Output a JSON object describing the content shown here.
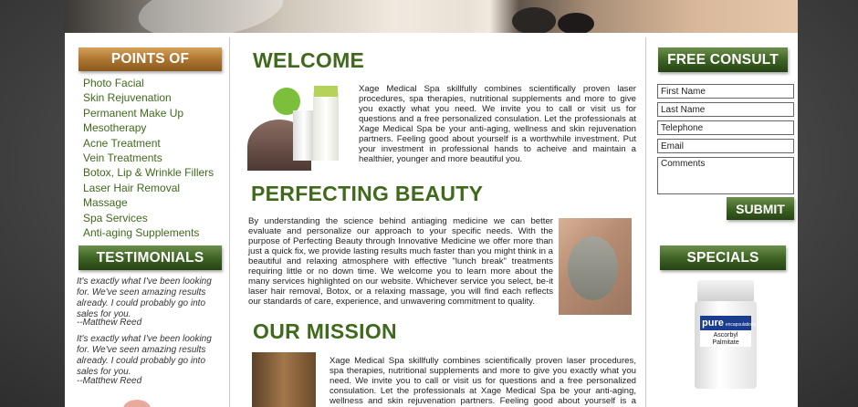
{
  "colors": {
    "accent_green": "#3f6a1c",
    "header_gold": "#ad7530",
    "header_green": "#3e6424"
  },
  "left": {
    "poi_title": "POINTS OF INTEREST",
    "poi_items": [
      "Photo Facial",
      "Skin Rejuvenation",
      "Permanent Make Up",
      "Mesotherapy",
      "Acne Treatment",
      "Vein Treatments",
      "Botox, Lip & Wrinkle Fillers",
      "Laser Hair Removal",
      "Massage",
      "Spa Services",
      "Anti-aging Supplements"
    ],
    "testimonials_title": "TESTIMONIALS",
    "testimonials": [
      {
        "quote": "It's exactly what I've been looking for. We've seen amazing results already. I could probably go into sales for you.",
        "author": "--Matthew Reed"
      },
      {
        "quote": "It's exactly what I've been looking for. We've seen amazing results already. I could probably go into sales for you.",
        "author": "--Matthew Reed"
      }
    ]
  },
  "main": {
    "welcome_title": "WELCOME",
    "welcome_text": "Xage Medical Spa skillfully combines scientifically proven laser procedures, spa therapies, nutritional supplements and more to give you exactly what you need.  We invite you to call or visit us for questions and a free personalized consulation. Let the professionals at Xage Medical Spa be your anti-aging, wellness and skin rejuvenation partners. Feeling good about yourself is a worthwhile investment. Put your investment in professional hands to acheive and maintain a healthier, younger and more beautiful you.",
    "perfecting_title": "PERFECTING BEAUTY",
    "perfecting_text": "By understanding the science behind antiaging medicine we can better evaluate and personalize our approach to your specific needs. With the purpose of Perfecting Beauty through Innovative Medicine we offer more than just a quick fix, we provide lasting results much faster than you might think in a beautiful and relaxing atmosphere with effective \"lunch break\" treatments requiring little or no down time. We welcome you to learn more about the many services highlighted on our website. Whichever service you select, be-it laser hair removal, Botox, or a relaxing massage, you will find each reflects our standards of care, experience, and unwavering commitment to quality.",
    "mission_title": "OUR MISSION",
    "mission_text": "Xage Medical Spa skillfully combines scientifically proven laser procedures, spa therapies, nutritional supplements and more to give you exactly what you need.  We invite you to call or visit us for questions and a free personalized consulation. Let the professionals at Xage Medical Spa be your anti-aging, wellness and skin rejuvenation partners. Feeling good about yourself is a worthwhile investment. Put your investment in"
  },
  "right": {
    "consult_title": "FREE CONSULT",
    "form": {
      "first_name": "First Name",
      "last_name": "Last Name",
      "telephone": "Telephone",
      "email": "Email",
      "comments": "Comments",
      "submit": "SUBMIT"
    },
    "specials_title": "SPECIALS",
    "product": {
      "brand": "pure",
      "sub": "encapsulations",
      "name1": "Ascorbyl",
      "name2": "Palmitate"
    }
  }
}
